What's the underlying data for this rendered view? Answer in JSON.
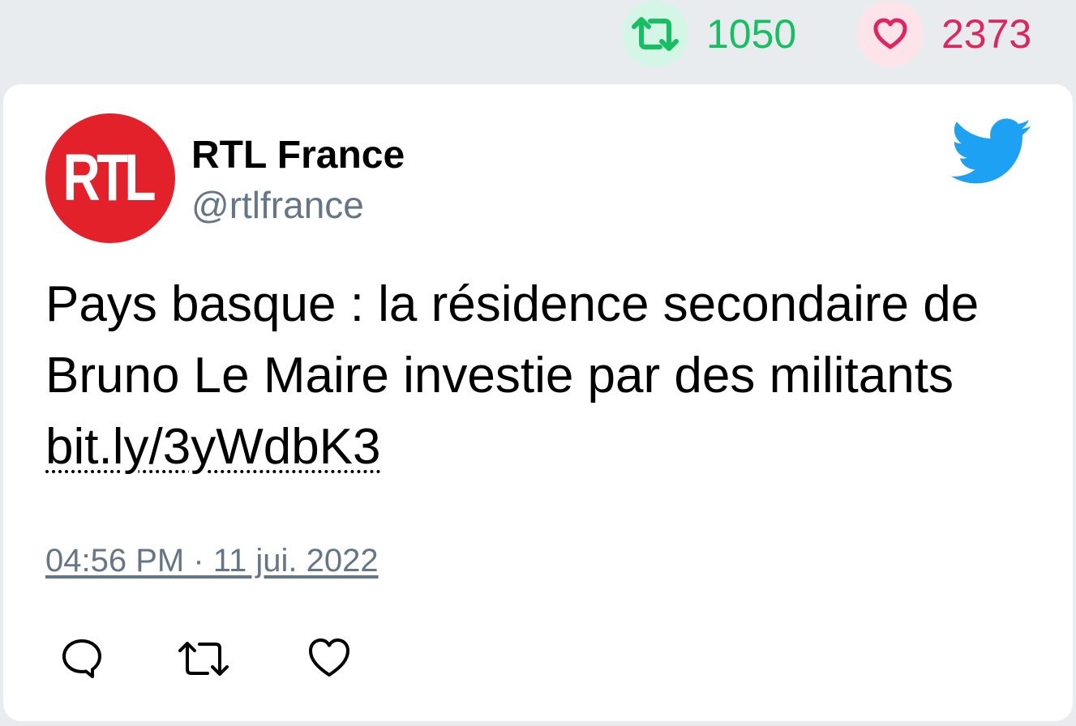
{
  "stats": {
    "retweet_count": "1050",
    "like_count": "2373",
    "retweet_icon": "retweet-icon",
    "like_icon": "heart-icon"
  },
  "tweet": {
    "author_name": "RTL France",
    "author_handle": "@rtlfrance",
    "avatar_logo_text": "RTL",
    "text": "Pays basque : la résidence secondaire de Bruno Le Maire investie par des militants ",
    "link_text": "bit.ly/3yWdbK3",
    "timestamp": "04:56 PM · 11 jui. 2022"
  },
  "actions": {
    "reply_icon": "reply-icon",
    "retweet_icon": "retweet-icon",
    "like_icon": "heart-icon"
  },
  "colors": {
    "retweet": "#17bf63",
    "like": "#e0245e",
    "twitter_blue": "#1da1f2",
    "avatar_red": "#e3212a",
    "muted": "#657786"
  }
}
